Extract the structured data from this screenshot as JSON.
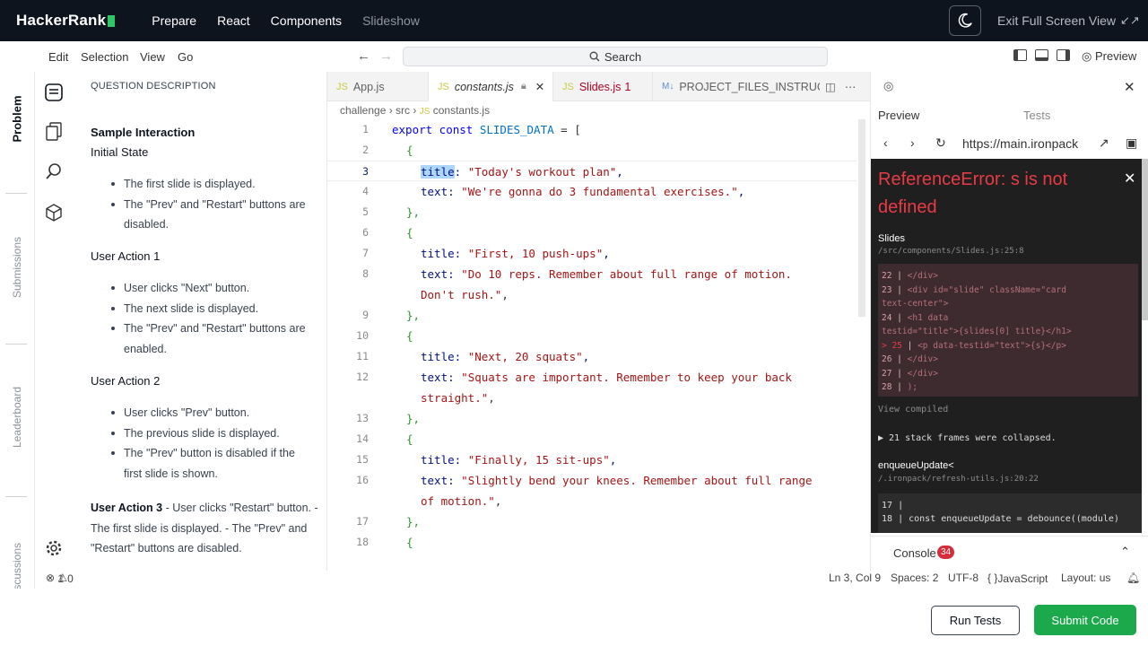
{
  "topbar": {
    "brand": "HackerRank",
    "crumbs": [
      "Prepare",
      "React",
      "Components"
    ],
    "current": "Slideshow",
    "exit_full_screen": "Exit Full Screen View"
  },
  "menu": {
    "items": [
      "Edit",
      "Selection",
      "View",
      "Go"
    ],
    "search": "Search",
    "preview": "Preview"
  },
  "sidebar_tabs": [
    "Problem",
    "Submissions",
    "Leaderboard",
    "Discussions"
  ],
  "description": {
    "title": "QUESTION DESCRIPTION",
    "sample": "Sample Interaction",
    "initial": "Initial State",
    "initial_items": [
      "The first slide is displayed.",
      "The \"Prev\" and \"Restart\" buttons are disabled."
    ],
    "action1": "User Action 1",
    "action1_items": [
      "User clicks \"Next\" button.",
      "The next slide is displayed.",
      "The \"Prev\" and \"Restart\" buttons are enabled."
    ],
    "action2": "User Action 2",
    "action2_items": [
      "User clicks \"Prev\" button.",
      "The previous slide is displayed.",
      "The \"Prev\" button is disabled if the first slide is shown."
    ],
    "action3_title": "User Action 3",
    "action3_text": " - User clicks \"Restart\" button. - The first slide is displayed. - The \"Prev\" and \"Restart\" buttons are disabled."
  },
  "editor": {
    "tabs": [
      {
        "label": "App.js",
        "kind": "js"
      },
      {
        "label": "constants.js",
        "kind": "js",
        "active": true
      },
      {
        "label": "Slides.js",
        "kind": "js",
        "problems": "1"
      },
      {
        "label": "PROJECT_FILES_INSTRUCTI",
        "kind": "md"
      }
    ],
    "breadcrumb": [
      "challenge",
      "src",
      "constants.js"
    ],
    "lines": {
      "l1": {
        "kw": "export const ",
        "cn": "SLIDES_DATA",
        "rest": " = ["
      },
      "l2": "{",
      "l3": {
        "prop": "title",
        "str": "\"Today's workout plan\""
      },
      "l4": {
        "prop": "text",
        "str": "\"We're gonna do 3 fundamental exercises.\""
      },
      "l5": "},",
      "l6": "{",
      "l7": {
        "prop": "title",
        "str": "\"First, 10 push-ups\""
      },
      "l8a": {
        "prop": "text",
        "str": "\"Do 10 reps. Remember about full range of motion."
      },
      "l8b": "Don't rush.\"",
      "l9": "},",
      "l10": "{",
      "l11": {
        "prop": "title",
        "str": "\"Next, 20 squats\""
      },
      "l12a": {
        "prop": "text",
        "str": "\"Squats are important. Remember to keep your back"
      },
      "l12b": "straight.\"",
      "l13": "},",
      "l14": "{",
      "l15": {
        "prop": "title",
        "str": "\"Finally, 15 sit-ups\""
      },
      "l16a": {
        "prop": "text",
        "str": "\"Slightly bend your knees. Remember about full range"
      },
      "l16b": "of motion.\"",
      "l17": "},",
      "l18": "{"
    }
  },
  "status": {
    "errors": "1",
    "warnings": "0",
    "position": "Ln 3, Col 9",
    "spaces": "Spaces: 2",
    "encoding": "UTF-8",
    "language": "JavaScript",
    "layout": "Layout: us"
  },
  "preview": {
    "tab_preview": "Preview",
    "tab_tests": "Tests",
    "url": "https://main.ironpack",
    "error_title": "ReferenceError: s is not defined",
    "component": "Slides",
    "component_path": "/src/components/Slides.js:25:8",
    "code": [
      {
        "n": "22",
        "c": "    </div>"
      },
      {
        "n": "23",
        "c": "    <div id=\"slide\" className=\"card"
      },
      {
        "n": "",
        "c": "text-center\">"
      },
      {
        "n": "24",
        "c": "      <h1 data"
      },
      {
        "n": "",
        "c": "testid=\"title\">{slides[0] title}</h1>"
      },
      {
        "n": "> 25",
        "c": "      <p data-testid=\"text\">{s}</p>"
      },
      {
        "n": "26",
        "c": "    </div>"
      },
      {
        "n": "27",
        "c": "  </div>"
      },
      {
        "n": "28",
        "c": " );"
      }
    ],
    "view_compiled": "View compiled",
    "collapsed": "▶  21 stack frames were collapsed.",
    "enqueue": "enqueueUpdate<",
    "enqueue_path": "/.ironpack/refresh-utils.js:20:22",
    "code2": [
      {
        "n": "17",
        "c": ""
      },
      {
        "n": "18",
        "c": "const enqueueUpdate = debounce((module)"
      }
    ],
    "console": "Console",
    "console_count": "34"
  },
  "footer": {
    "run": "Run Tests",
    "submit": "Submit Code"
  }
}
